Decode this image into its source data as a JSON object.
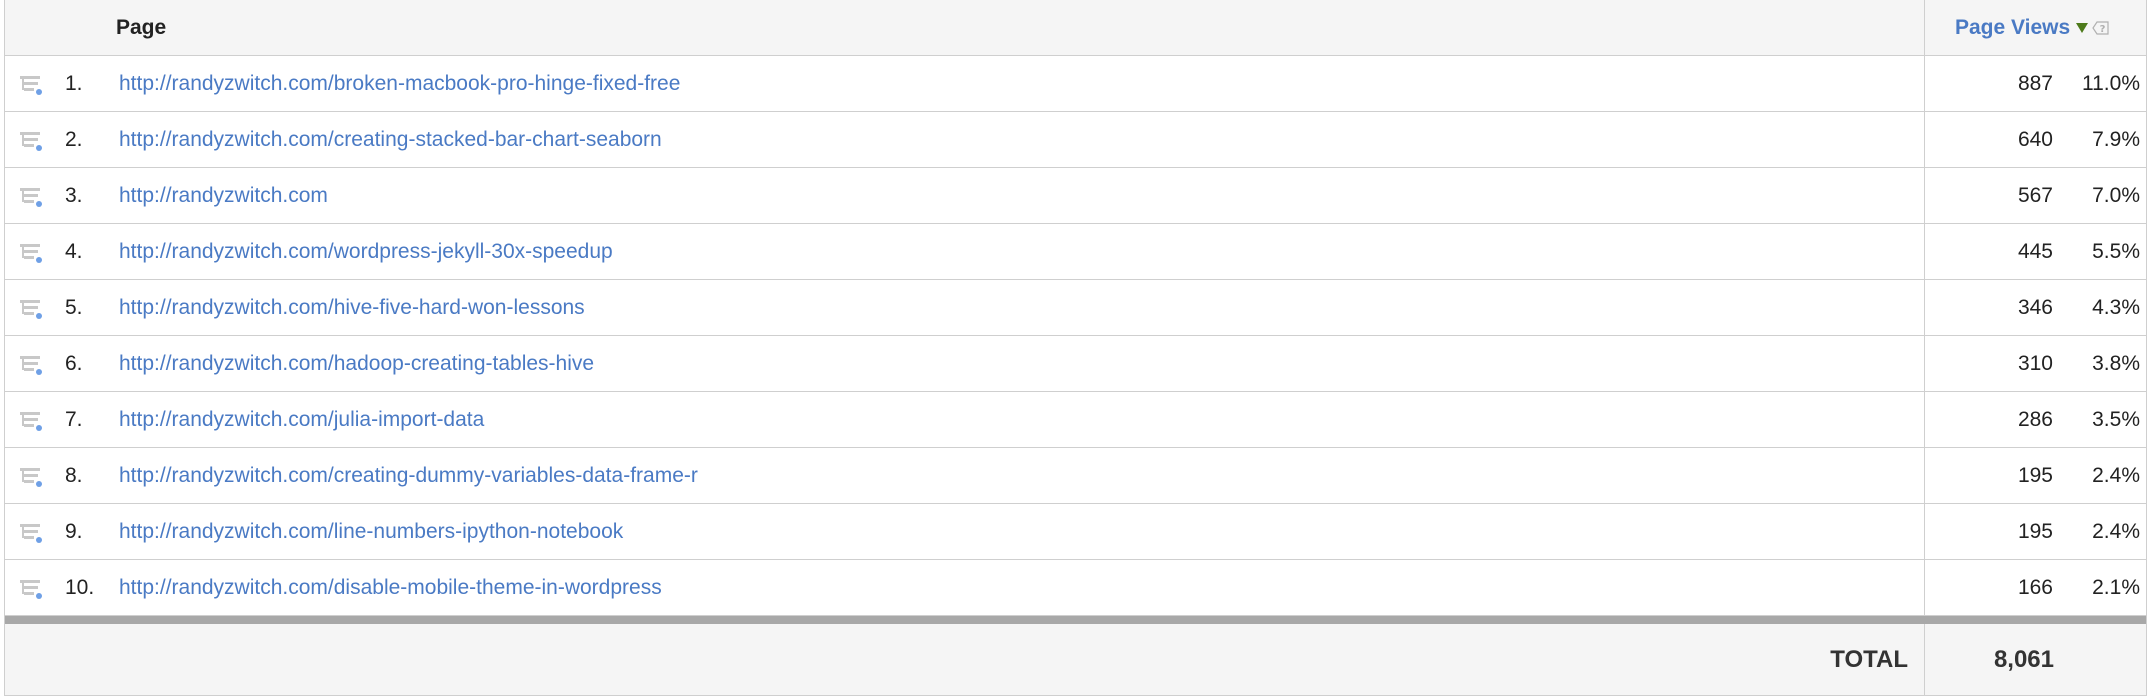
{
  "header": {
    "page_label": "Page",
    "views_label": "Page Views"
  },
  "rows": [
    {
      "rank": "1.",
      "url": "http://randyzwitch.com/broken-macbook-pro-hinge-fixed-free",
      "views": "887",
      "pct": "11.0%"
    },
    {
      "rank": "2.",
      "url": "http://randyzwitch.com/creating-stacked-bar-chart-seaborn",
      "views": "640",
      "pct": "7.9%"
    },
    {
      "rank": "3.",
      "url": "http://randyzwitch.com",
      "views": "567",
      "pct": "7.0%"
    },
    {
      "rank": "4.",
      "url": "http://randyzwitch.com/wordpress-jekyll-30x-speedup",
      "views": "445",
      "pct": "5.5%"
    },
    {
      "rank": "5.",
      "url": "http://randyzwitch.com/hive-five-hard-won-lessons",
      "views": "346",
      "pct": "4.3%"
    },
    {
      "rank": "6.",
      "url": "http://randyzwitch.com/hadoop-creating-tables-hive",
      "views": "310",
      "pct": "3.8%"
    },
    {
      "rank": "7.",
      "url": "http://randyzwitch.com/julia-import-data",
      "views": "286",
      "pct": "3.5%"
    },
    {
      "rank": "8.",
      "url": "http://randyzwitch.com/creating-dummy-variables-data-frame-r",
      "views": "195",
      "pct": "2.4%"
    },
    {
      "rank": "9.",
      "url": "http://randyzwitch.com/line-numbers-ipython-notebook",
      "views": "195",
      "pct": "2.4%"
    },
    {
      "rank": "10.",
      "url": "http://randyzwitch.com/disable-mobile-theme-in-wordpress",
      "views": "166",
      "pct": "2.1%"
    }
  ],
  "total": {
    "label": "TOTAL",
    "value": "8,061"
  },
  "colors": {
    "link": "#4a7ac4",
    "sort_arrow": "#4d7a1a",
    "header_bg": "#f5f5f5",
    "divider": "#a8a8a8"
  },
  "icons": {
    "breakdown": "breakdown-icon",
    "sort": "sort-descending-icon",
    "help": "help-icon"
  }
}
